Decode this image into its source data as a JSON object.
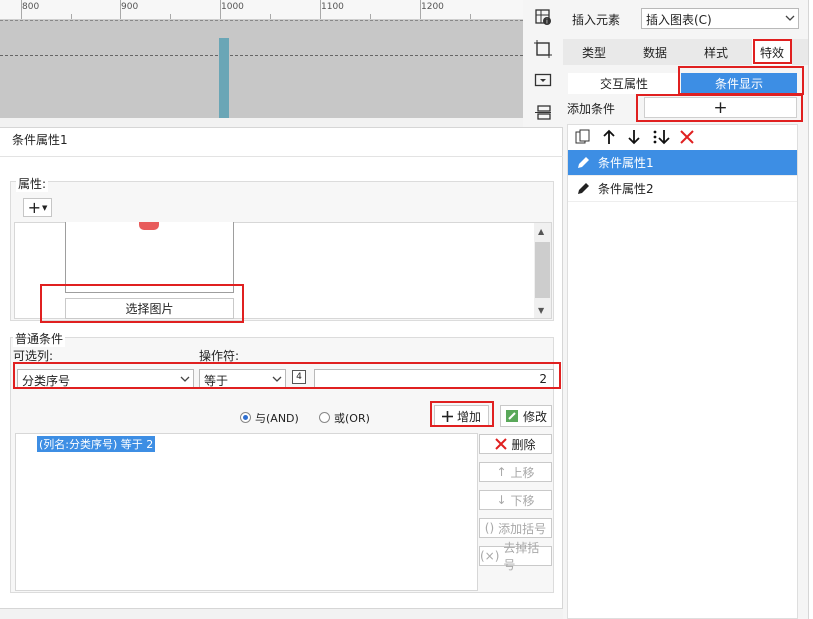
{
  "ruler": {
    "labels": [
      "800",
      "900",
      "1000",
      "1100",
      "1200"
    ]
  },
  "toolbar": {
    "icons": [
      "grid-settings-icon",
      "crop-frame-icon",
      "dropdown-box-icon",
      "layers-icon"
    ]
  },
  "left": {
    "title": "条件属性1",
    "attr_label": "属性:",
    "add_attr": "+",
    "select_image": "选择图片",
    "general_conditions": "普通条件",
    "column_label": "可选列:",
    "operator_label": "操作符:",
    "column_value": "分类序号",
    "operator_value": "等于",
    "mode_icon": "4",
    "value": "2",
    "and_label": "与(AND)",
    "or_label": "或(OR)",
    "add_button": "增加",
    "modify_button": "修改",
    "condition_item": "(列名:分类序号) 等于 2",
    "delete_button": "删除",
    "up_button": "上移",
    "down_button": "下移",
    "add_bracket_button": "添加括号",
    "remove_bracket_button": "去掉括号"
  },
  "right": {
    "insert_label": "插入元素",
    "insert_select": "插入图表(C)",
    "tabs": [
      "类型",
      "数据",
      "样式",
      "特效"
    ],
    "subtabs": [
      "交互属性",
      "条件显示"
    ],
    "add_condition_label": "添加条件",
    "add_condition_button": "+",
    "items": [
      "条件属性1",
      "条件属性2"
    ]
  },
  "colors": {
    "accent": "#3d8ee4",
    "highlight": "#e02020",
    "guide": "#6aa6b6"
  }
}
